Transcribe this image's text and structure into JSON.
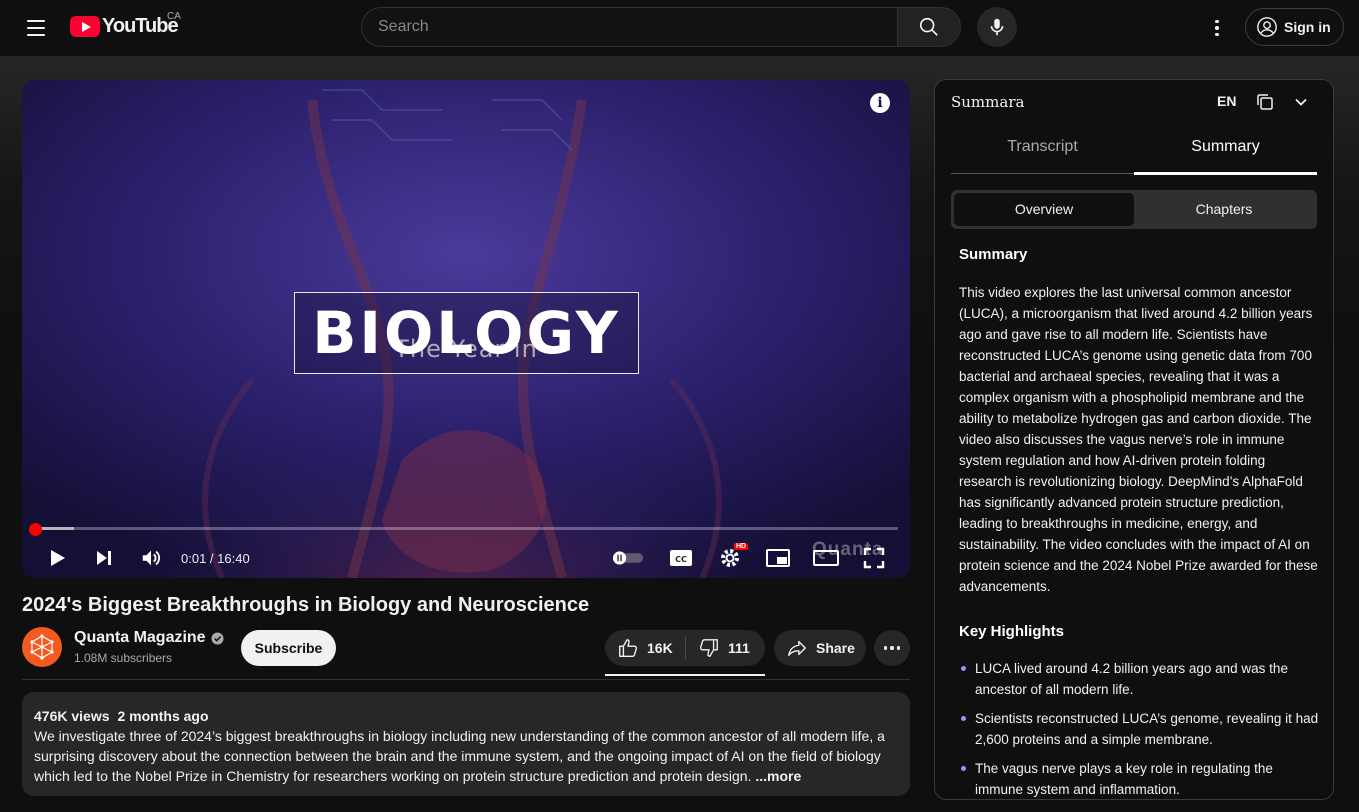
{
  "header": {
    "logo_text": "YouTube",
    "country_code": "CA",
    "search_placeholder": "Search",
    "sign_in_label": "Sign in"
  },
  "player": {
    "title_line1": "The Year in",
    "title_line2": "BIOLOGY",
    "current_time": "0:01",
    "duration": "16:40",
    "time_display": "0:01 / 16:40",
    "progress_fraction": 0.001,
    "buffered_fraction": 0.045,
    "hd_badge": "HD",
    "watermark": "Quanta"
  },
  "video": {
    "title": "2024's Biggest Breakthroughs in Biology and Neuroscience",
    "channel_name": "Quanta Magazine",
    "subscribers": "1.08M subscribers",
    "subscribe_label": "Subscribe",
    "likes": "16K",
    "dislikes": "111",
    "share_label": "Share",
    "views": "476K views",
    "age": "2 months ago",
    "description": "We investigate three of 2024’s biggest breakthroughs in biology including new understanding of the common ancestor of all modern life, a surprising discovery about the connection between the brain and the immune system, and the ongoing impact of AI on the field of biology which led to the Nobel Prize in Chemistry for researchers working on protein structure prediction and protein design.",
    "more_label": "...more"
  },
  "panel": {
    "brand": "Summara",
    "language": "EN",
    "tabs": [
      "Transcript",
      "Summary"
    ],
    "active_tab": "Summary",
    "segments": [
      "Overview",
      "Chapters"
    ],
    "active_segment": "Overview",
    "summary_heading": "Summary",
    "summary_text": "This video explores the last universal common ancestor (LUCA), a microorganism that lived around 4.2 billion years ago and gave rise to all modern life. Scientists have reconstructed LUCA’s genome using genetic data from 700 bacterial and archaeal species, revealing that it was a complex organism with a phospholipid membrane and the ability to metabolize hydrogen gas and carbon dioxide. The video also discusses the vagus nerve’s role in immune system regulation and how AI-driven protein folding research is revolutionizing biology. DeepMind’s AlphaFold has significantly advanced protein structure prediction, leading to breakthroughs in medicine, energy, and sustainability. The video concludes with the impact of AI on protein science and the 2024 Nobel Prize awarded for these advancements.",
    "highlights_heading": "Key Highlights",
    "highlights": [
      "LUCA lived around 4.2 billion years ago and was the ancestor of all modern life.",
      "Scientists reconstructed LUCA’s genome, revealing it had 2,600 proteins and a simple membrane.",
      "The vagus nerve plays a key role in regulating the immune system and inflammation."
    ],
    "bullet_color": "#a78bfa"
  },
  "colors": {
    "background": "#0f0f0f",
    "youtube_red": "#ff0033",
    "progress_red": "#ff0000",
    "avatar_orange": "#f25a1f"
  },
  "icons": [
    "menu-icon",
    "youtube-logo-icon",
    "search-icon",
    "mic-icon",
    "more-vert-icon",
    "account-icon",
    "info-icon",
    "play-icon",
    "next-icon",
    "volume-icon",
    "autoplay-toggle-icon",
    "captions-icon",
    "settings-icon",
    "miniplayer-icon",
    "theater-icon",
    "fullscreen-icon",
    "verified-icon",
    "like-icon",
    "dislike-icon",
    "share-icon",
    "more-horiz-icon",
    "copy-icon",
    "chevron-down-icon"
  ]
}
